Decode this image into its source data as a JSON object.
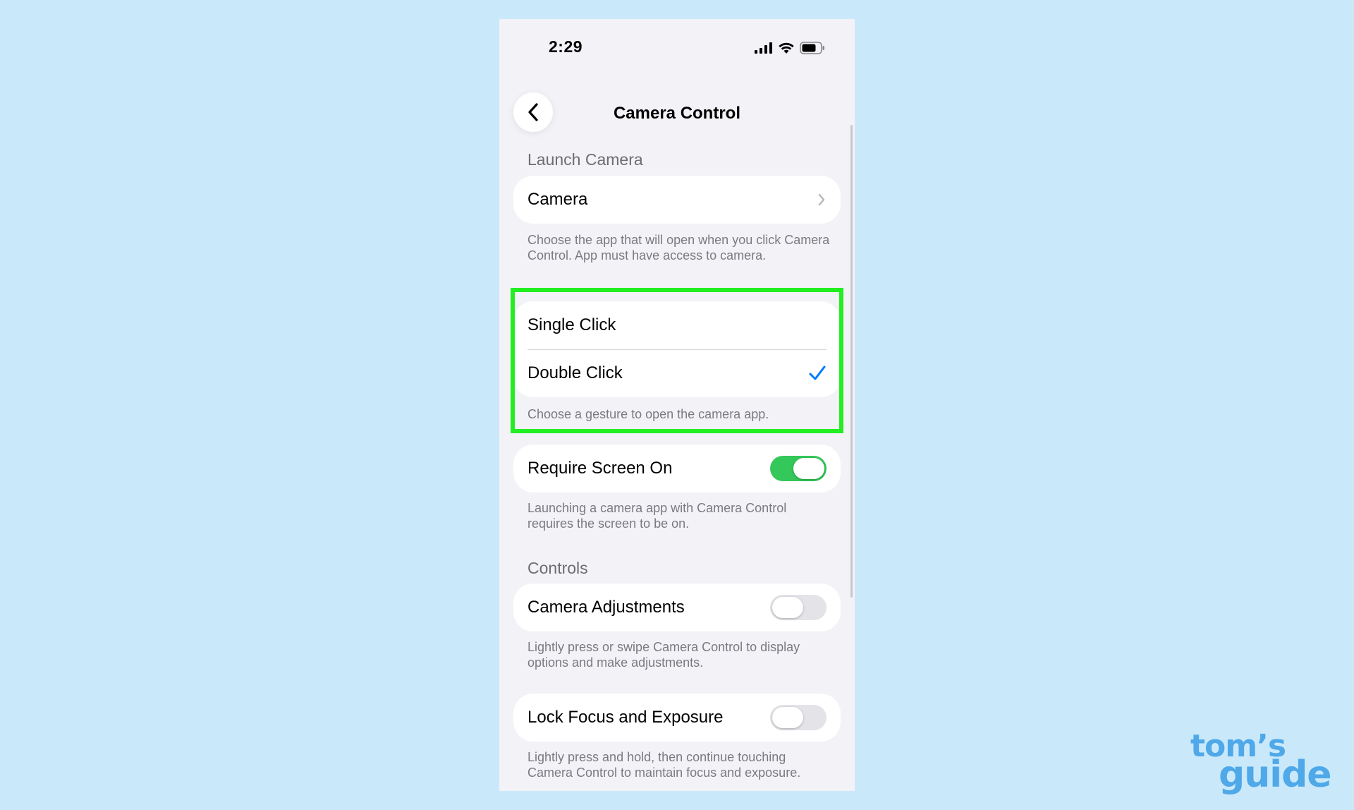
{
  "status_bar": {
    "time": "2:29"
  },
  "nav": {
    "title": "Camera Control"
  },
  "launch_camera": {
    "header": "Launch Camera",
    "app_row_label": "Camera",
    "footer": "Choose the app that will open when you click Camera Control. App must have access to camera."
  },
  "gesture": {
    "options": [
      {
        "label": "Single Click",
        "selected": false
      },
      {
        "label": "Double Click",
        "selected": true
      }
    ],
    "footer": "Choose a gesture to open the camera app."
  },
  "require_screen_on": {
    "label": "Require Screen On",
    "enabled": true,
    "footer": "Launching a camera app with Camera Control requires the screen to be on."
  },
  "controls": {
    "header": "Controls",
    "camera_adjustments": {
      "label": "Camera Adjustments",
      "enabled": false,
      "footer": "Lightly press or swipe Camera Control to display options and make adjustments."
    },
    "lock_focus": {
      "label": "Lock Focus and Exposure",
      "enabled": false,
      "footer": "Lightly press and hold, then continue touching Camera Control to maintain focus and exposure."
    }
  },
  "colors": {
    "highlight": "#22ee22",
    "toggle_on": "#34c759",
    "checkmark": "#007aff",
    "background": "#c9e9fb"
  },
  "logo": {
    "line1": "tom’s",
    "line2": "guide"
  }
}
